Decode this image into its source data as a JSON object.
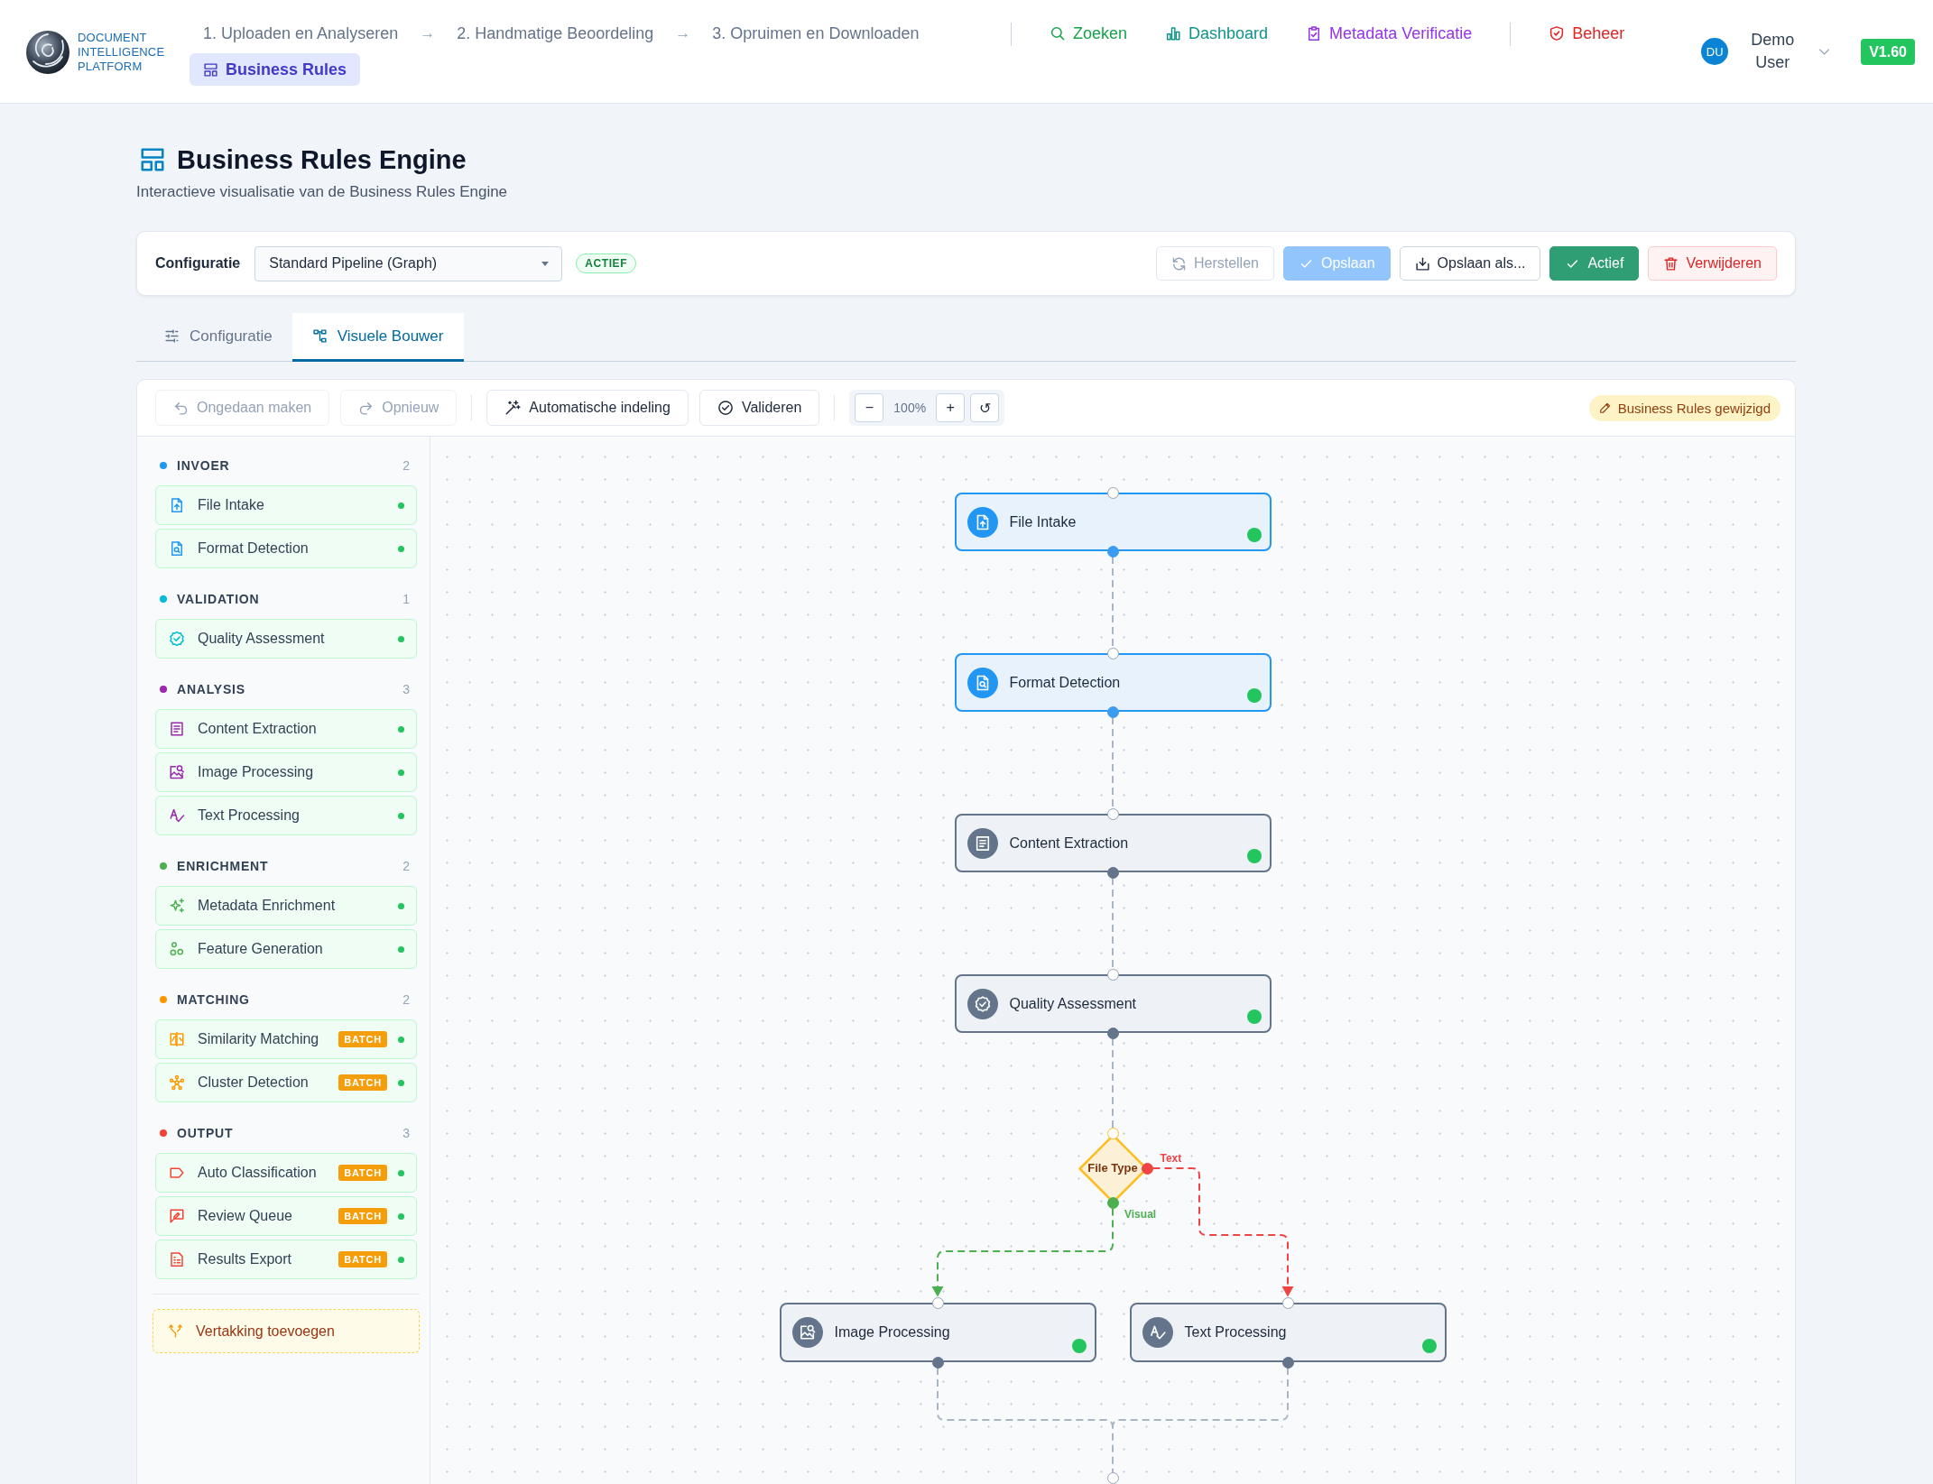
{
  "nav": {
    "brand": "DOCUMENT INTELLIGENCE PLATFORM",
    "steps": [
      {
        "label": "1. Uploaden en Analyseren",
        "kind": "workflow",
        "selected": false
      },
      {
        "label": "2. Handmatige Beoordeling",
        "kind": "workflow",
        "selected": false
      },
      {
        "label": "3. Opruimen en Downloaden",
        "kind": "workflow",
        "selected": false
      },
      {
        "label": "Business Rules",
        "kind": "rules",
        "selected": true
      }
    ],
    "step_arrows": [
      "→",
      "→"
    ],
    "links": [
      {
        "label": "Zoeken",
        "kind": "search",
        "color": "#16a34a"
      },
      {
        "label": "Dashboard",
        "kind": "dashboard",
        "color": "#0d9488"
      },
      {
        "label": "Metadata Verificatie",
        "kind": "verification",
        "color": "#9333ea"
      }
    ],
    "admin_links": [
      {
        "label": "Beheer",
        "kind": "admin",
        "color": "#dc2626"
      }
    ],
    "user": {
      "initials": "DU",
      "name": "Demo User"
    },
    "version": "V1.60"
  },
  "header": {
    "title": "Business Rules Engine",
    "subtitle": "Interactieve visualisatie van de Business Rules Engine"
  },
  "config_bar": {
    "label": "Configuratie",
    "select_value": "Standard Pipeline (Graph)",
    "status": "ACTIEF",
    "buttons": [
      {
        "label": "Herstellen",
        "kind": "reset",
        "disabled": true
      },
      {
        "label": "Opslaan",
        "kind": "save",
        "disabled": true
      },
      {
        "label": "Opslaan als...",
        "kind": "save_as",
        "disabled": false
      },
      {
        "label": "Actief",
        "kind": "active",
        "disabled": false
      },
      {
        "label": "Verwijderen",
        "kind": "delete",
        "disabled": false
      }
    ]
  },
  "tabs": [
    {
      "label": "Configuratie",
      "kind": "settings",
      "selected": false
    },
    {
      "label": "Visuele Bouwer",
      "kind": "builder",
      "selected": true
    }
  ],
  "toolbar": {
    "history": [
      {
        "label": "Ongedaan maken",
        "kind": "undo",
        "disabled": true
      },
      {
        "label": "Opnieuw",
        "kind": "redo",
        "disabled": true
      }
    ],
    "actions": [
      {
        "label": "Automatische indeling",
        "kind": "auto_layout"
      },
      {
        "label": "Valideren",
        "kind": "validate"
      }
    ],
    "zoom": {
      "out": "−",
      "level": "100%",
      "in": "+",
      "reset": "↺"
    },
    "change_badge": "Business Rules gewijzigd"
  },
  "palette": {
    "groups": [
      {
        "name": "INVOER",
        "count": "2",
        "color": "#2196f3",
        "items": [
          {
            "label": "File Intake",
            "kind": "file_intake"
          },
          {
            "label": "Format Detection",
            "kind": "format_detection"
          }
        ]
      },
      {
        "name": "VALIDATION",
        "count": "1",
        "color": "#00bcd4",
        "items": [
          {
            "label": "Quality Assessment",
            "kind": "quality"
          }
        ]
      },
      {
        "name": "ANALYSIS",
        "count": "3",
        "color": "#9c27b0",
        "items": [
          {
            "label": "Content Extraction",
            "kind": "content_extraction"
          },
          {
            "label": "Image Processing",
            "kind": "image_processing"
          },
          {
            "label": "Text Processing",
            "kind": "text_processing"
          }
        ]
      },
      {
        "name": "ENRICHMENT",
        "count": "2",
        "color": "#4caf50",
        "items": [
          {
            "label": "Metadata Enrichment",
            "kind": "metadata_enrichment"
          },
          {
            "label": "Feature Generation",
            "kind": "feature_generation"
          }
        ]
      },
      {
        "name": "MATCHING",
        "count": "2",
        "color": "#ff9800",
        "items": [
          {
            "label": "Similarity Matching",
            "kind": "similarity",
            "badge": "BATCH"
          },
          {
            "label": "Cluster Detection",
            "kind": "clustering",
            "badge": "BATCH"
          }
        ]
      },
      {
        "name": "OUTPUT",
        "count": "3",
        "color": "#f44336",
        "items": [
          {
            "label": "Auto Classification",
            "kind": "classification",
            "badge": "BATCH"
          },
          {
            "label": "Review Queue",
            "kind": "review",
            "badge": "BATCH"
          },
          {
            "label": "Results Export",
            "kind": "export",
            "badge": "BATCH"
          }
        ]
      }
    ],
    "add_branch": "Vertakking toevoegen"
  },
  "canvas": {
    "nodes": [
      {
        "label": "File Intake",
        "kind": "file_intake",
        "selected": true
      },
      {
        "label": "Format Detection",
        "kind": "format_detection",
        "selected": true
      },
      {
        "label": "Content Extraction",
        "kind": "content_extraction",
        "selected": false
      },
      {
        "label": "Quality Assessment",
        "kind": "quality",
        "selected": false
      },
      {
        "label": "File Type",
        "kind": "decision",
        "branches": [
          {
            "label": "Visual",
            "color": "#4caf50"
          },
          {
            "label": "Text",
            "color": "#ef4444"
          }
        ]
      },
      {
        "label": "Image Processing",
        "kind": "image_processing",
        "selected": false
      },
      {
        "label": "Text Processing",
        "kind": "text_processing",
        "selected": false
      }
    ]
  }
}
